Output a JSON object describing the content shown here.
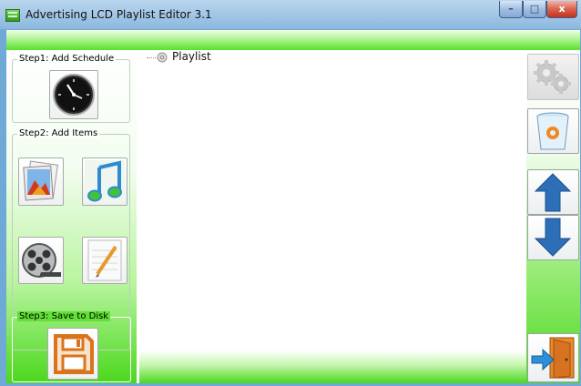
{
  "window": {
    "title": "Advertising LCD Playlist Editor 3.1",
    "min_glyph": "–",
    "max_glyph": "□",
    "close_glyph": "x"
  },
  "left_panel": {
    "step1": {
      "title": "Step1: Add Schedule",
      "buttons": [
        {
          "icon": "clock-icon"
        }
      ]
    },
    "step2": {
      "title": "Step2: Add Items",
      "buttons": [
        {
          "icon": "image-gallery-icon"
        },
        {
          "icon": "music-note-icon"
        },
        {
          "icon": "film-reel-icon"
        },
        {
          "icon": "notepad-pencil-icon"
        }
      ]
    },
    "step3": {
      "title": "Step3: Save to Disk",
      "buttons": [
        {
          "icon": "floppy-disk-icon"
        }
      ]
    }
  },
  "tree": {
    "root_label": "Playlist",
    "root_icon": "playlist-disc-icon"
  },
  "right_panel": {
    "buttons": [
      {
        "icon": "gears-icon",
        "enabled": false
      },
      {
        "icon": "recycle-bin-icon",
        "enabled": true
      },
      {
        "icon": "arrow-up-icon",
        "enabled": true
      },
      {
        "icon": "arrow-down-icon",
        "enabled": true
      },
      {
        "icon": "exit-door-icon",
        "enabled": true
      }
    ]
  },
  "colors": {
    "accent_green": "#4ad81c",
    "arrow_blue": "#2c6fb8",
    "floppy_orange": "#d9731c"
  }
}
